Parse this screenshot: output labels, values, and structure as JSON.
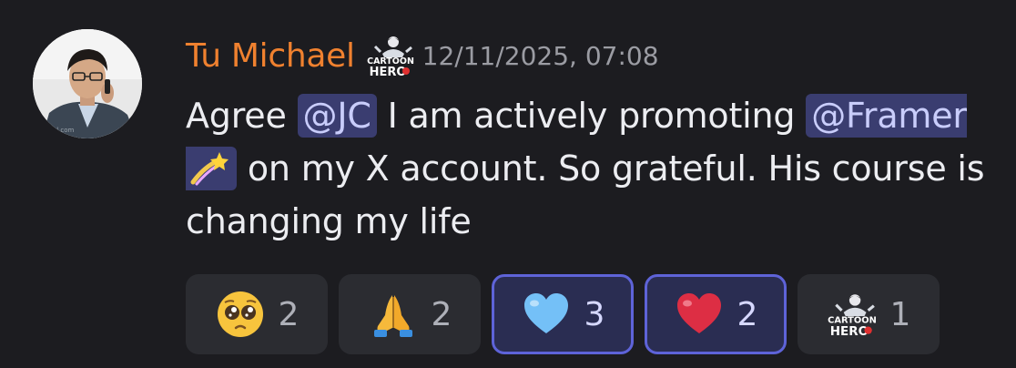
{
  "message": {
    "author": "Tu Michael",
    "role_badge": "CARTOON HERO",
    "timestamp": "12/11/2025, 07:08",
    "avatar_caption": "ial.com",
    "content": {
      "part1": "Agree ",
      "mention1": "@JC",
      "part2": " I am actively promoting ",
      "mention2": "@Framer",
      "mention2_icon": "shooting-star-emoji",
      "part3": " on my X account. So grateful. His course is changing my life"
    },
    "reactions": [
      {
        "icon": "pleading-face-emoji",
        "count": "2",
        "active": false
      },
      {
        "icon": "folded-hands-emoji",
        "count": "2",
        "active": false
      },
      {
        "icon": "light-blue-heart-emoji",
        "count": "3",
        "active": true
      },
      {
        "icon": "red-heart-emoji",
        "count": "2",
        "active": true
      },
      {
        "icon": "cartoon-hero-emoji",
        "count": "1",
        "active": false,
        "label": "CARTOON HERO"
      }
    ]
  },
  "colors": {
    "background": "#1c1c20",
    "username": "#f0812f",
    "mention_bg": "#3a3d70",
    "mention_text": "#c9cdfb",
    "reaction_bg": "#2b2c31",
    "reaction_active_border": "#5e63d8"
  }
}
